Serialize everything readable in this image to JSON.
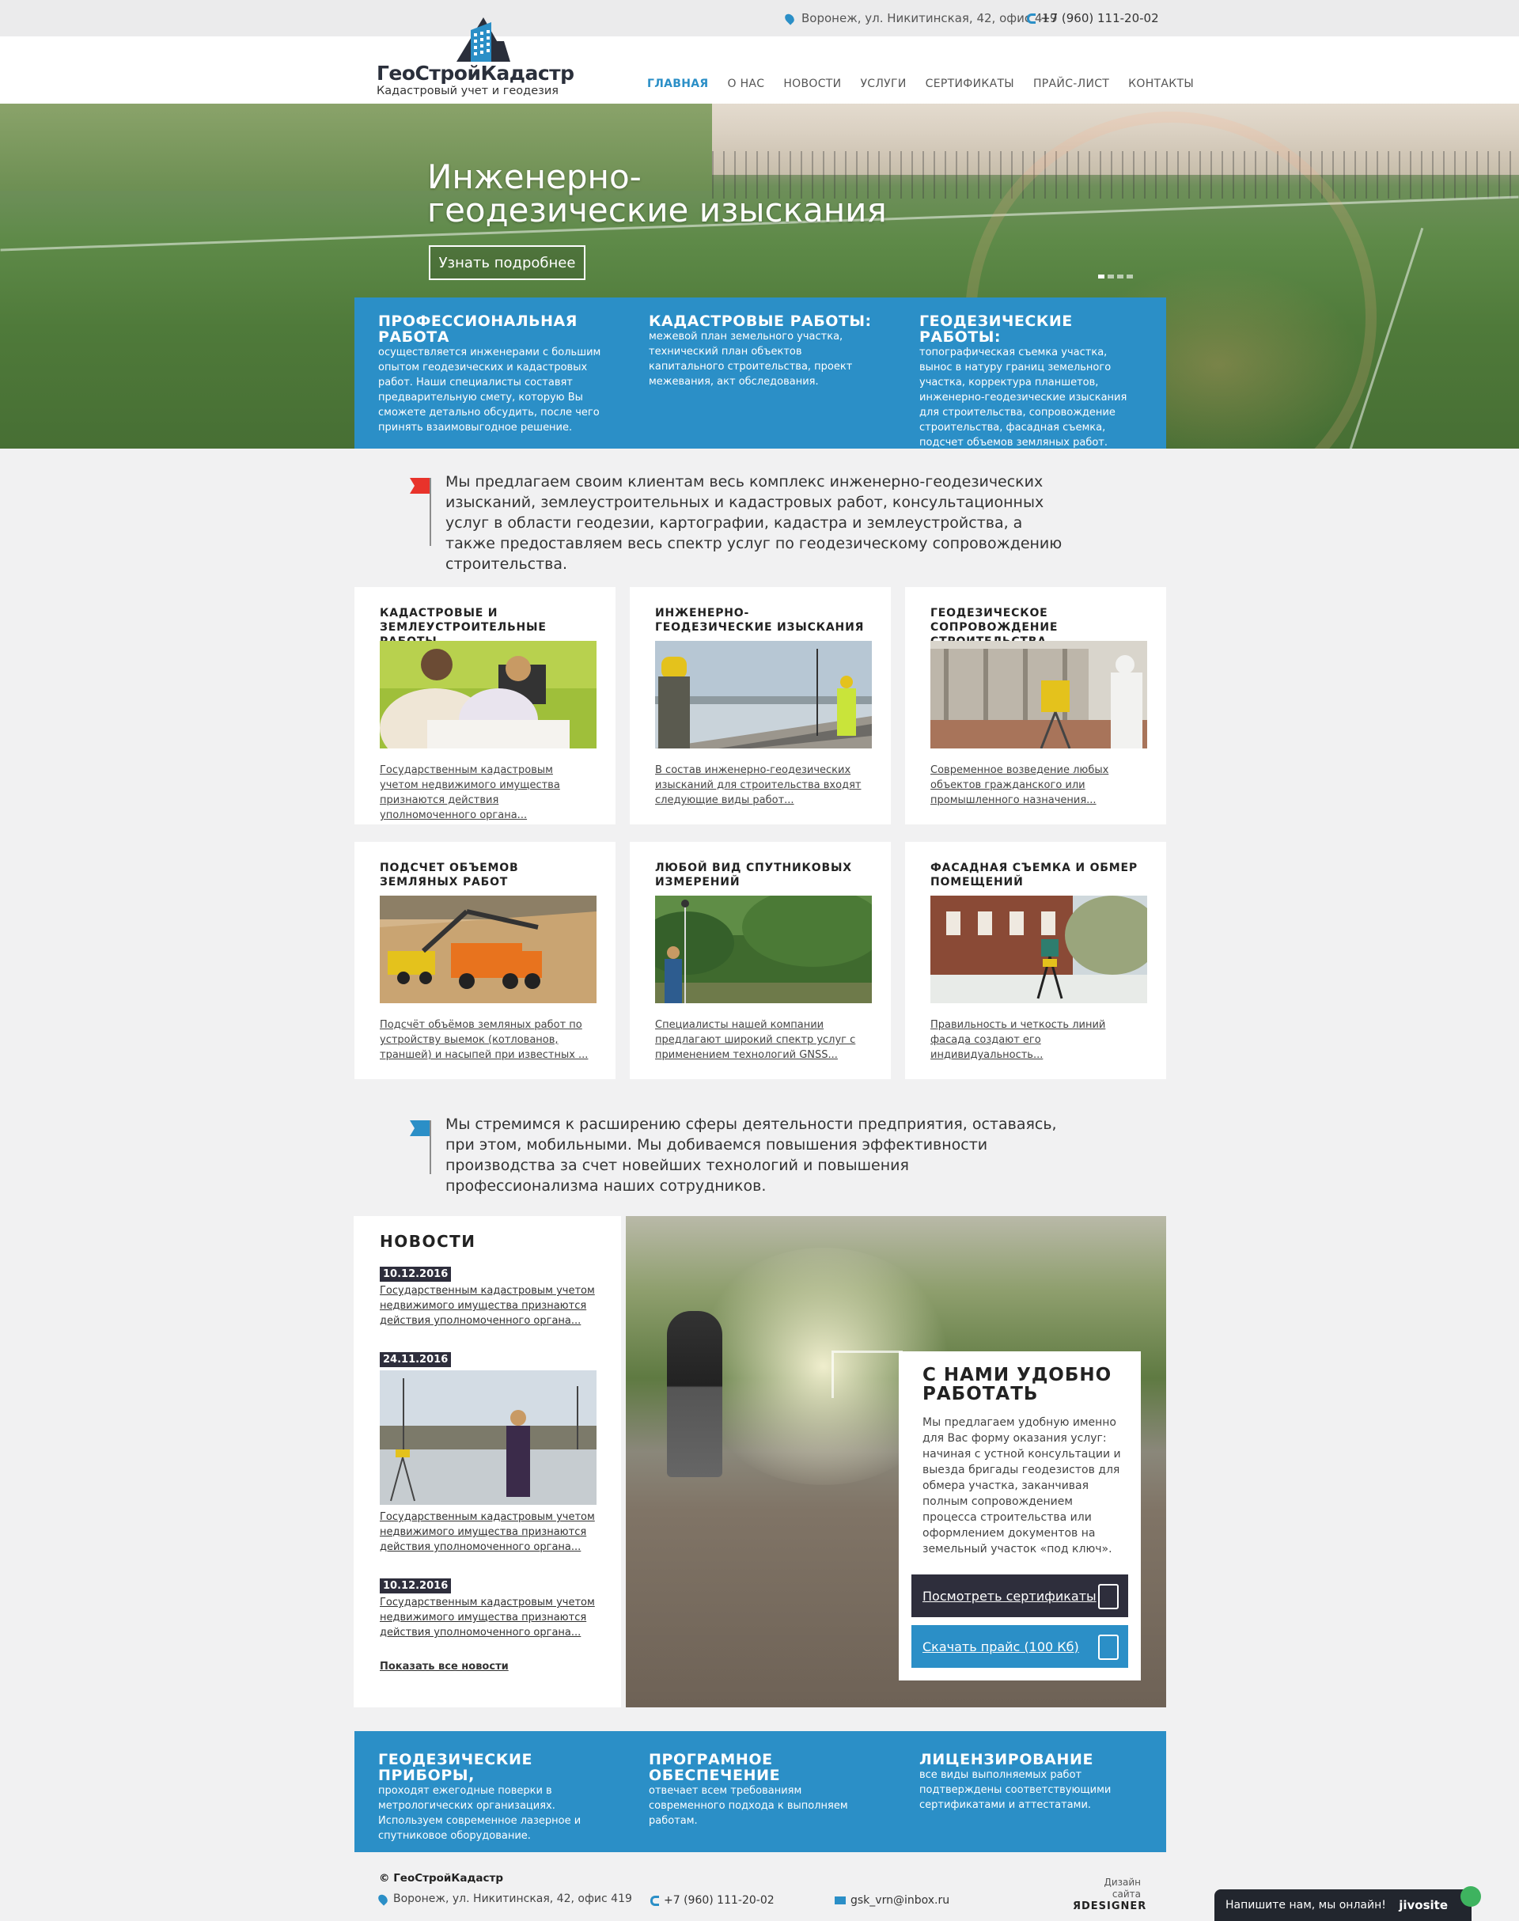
{
  "topbar": {
    "address": "Воронеж, ул. Никитинская, 42, офис 419",
    "phone": "+7 (960) 111-20-02"
  },
  "logo": {
    "name": "ГеоСтройКадастр",
    "tagline": "Кадастровый учет и геодезия"
  },
  "nav": {
    "items": [
      "ГЛАВНАЯ",
      "О НАС",
      "НОВОСТИ",
      "УСЛУГИ",
      "СЕРТИФИКАТЫ",
      "ПРАЙС-ЛИСТ",
      "КОНТАКТЫ"
    ],
    "active": "ГЛАВНАЯ"
  },
  "hero": {
    "title": "Инженерно-геодезические изыскания",
    "button": "Узнать подробнее",
    "slides": 4,
    "active_slide": 1
  },
  "hero_panel": [
    {
      "title": "ПРОФЕССИОНАЛЬНАЯ РАБОТА",
      "text": "осуществляется инженерами с большим опытом геодезических и кадастровых работ. Наши специалисты составят предварительную смету, которую Вы сможете детально обсудить, после чего принять взаимовыгодное решение."
    },
    {
      "title": "КАДАСТРОВЫЕ РАБОТЫ:",
      "text": "межевой план земельного участка, технический план объектов капитального строительства, проект межевания, акт обследования."
    },
    {
      "title": "ГЕОДЕЗИЧЕСКИЕ РАБОТЫ:",
      "text": "топографическая съемка участка, вынос в натуру границ земельного участка, корректура планшетов, инженерно-геодезические изыскания для строительства, сопровождение строительства, фасадная съемка, подсчет объемов земляных работ."
    }
  ],
  "intro": {
    "text": "Мы предлагаем своим клиентам весь комплекс инженерно-геодезических изысканий, землеустроительных и кадастровых работ, консультационных услуг в области геодезии, картографии, кадастра и землеустройства, а также предоставляем весь спектр услуг по геодезическому сопровождению строительства."
  },
  "services": [
    {
      "title": "КАДАСТРОВЫЕ И ЗЕМЛЕУСТРОИТЕЛЬНЫЕ РАБОТЫ",
      "text": "Государственным кадастровым учетом недвижимого имущества  признаются действия уполномоченного органа..."
    },
    {
      "title": "ИНЖЕНЕРНО-ГЕОДЕЗИЧЕСКИЕ ИЗЫСКАНИЯ",
      "text": "В состав инженерно-геодезических изысканий для строительства входят следующие виды работ..."
    },
    {
      "title": "ГЕОДЕЗИЧЕСКОЕ СОПРОВОЖДЕНИЕ СТРОИТЕЛЬСТВА",
      "text": "Современное возведение любых объектов гражданского или промышленного назначения..."
    },
    {
      "title": "ПОДСЧЕТ ОБЪЕМОВ ЗЕМЛЯНЫХ РАБОТ",
      "text": "Подсчёт объёмов земляных работ по устройству выемок (котлованов, траншей) и насыпей при известных ..."
    },
    {
      "title": "ЛЮБОЙ ВИД СПУТНИКОВЫХ ИЗМЕРЕНИЙ",
      "text": "Специалисты нашей компании предлагают широкий спектр услуг с применением технологий GNSS..."
    },
    {
      "title": "ФАСАДНАЯ СЪЕМКА И ОБМЕР ПОМЕЩЕНИЙ",
      "text": "Правильность и четкость линий фасада создают его индивидуальность..."
    }
  ],
  "intro2": {
    "text": "Мы стремимся к расширению сферы деятельности предприятия, оставаясь, при этом, мобильными. Мы добиваемся повышения эффективности производства за счет новейших технологий и повышения профессионализма наших сотрудников."
  },
  "news": {
    "title": "НОВОСТИ",
    "items": [
      {
        "date": "10.12.2016",
        "text": "Государственным кадастровым учетом недвижимого имущества  признаются действия уполномоченного органа..."
      },
      {
        "date": "24.11.2016",
        "text": "Государственным кадастровым учетом недвижимого имущества  признаются действия уполномоченного органа..."
      },
      {
        "date": "10.12.2016",
        "text": "Государственным кадастровым учетом недвижимого имущества  признаются действия уполномоченного органа..."
      }
    ],
    "all_link": "Показать все новости"
  },
  "promo": {
    "title": "С НАМИ УДОБНО РАБОТАТЬ",
    "text": "Мы предлагаем удобную именно для Вас форму оказания услуг: начиная с устной консультации и выезда бригады геодезистов для обмера участка, заканчивая полным сопровождением процесса строительства или оформлением документов на земельный участок «под ключ».",
    "btn_certs": "Посмотреть сертификаты",
    "btn_price": "Скачать прайс (100 Кб)"
  },
  "features": [
    {
      "title": "ГЕОДЕЗИЧЕСКИЕ ПРИБОРЫ,",
      "text": "проходят ежегодные поверки в метрологических организациях. Используем современное лазерное и спутниковое оборудование."
    },
    {
      "title": "ПРОГРАМНОЕ ОБЕСПЕЧЕНИЕ",
      "text": "отвечает всем требованиям современного подхода к выполняем работам."
    },
    {
      "title": "ЛИЦЕНЗИРОВАНИЕ",
      "text": "все виды выполняемых работ подтверждены соответствующими сертификатами и аттестатами."
    }
  ],
  "footer": {
    "copyright": "© ГеоСтройКадастр",
    "address": "Воронеж, ул. Никитинская, 42, офис 419",
    "phone": "+7 (960) 111-20-02",
    "email": "gsk_vrn@inbox.ru",
    "design_label": "Дизайн сайта",
    "design_brand": "ЯDESIGNER"
  },
  "chat": {
    "text": "Напишите нам, мы онлайн!",
    "brand": "jivosite"
  },
  "colors": {
    "accent": "#2b8fc7",
    "dark": "#2e2e3c",
    "flag_red": "#e8332b",
    "flag_blue": "#2b8fc7"
  }
}
